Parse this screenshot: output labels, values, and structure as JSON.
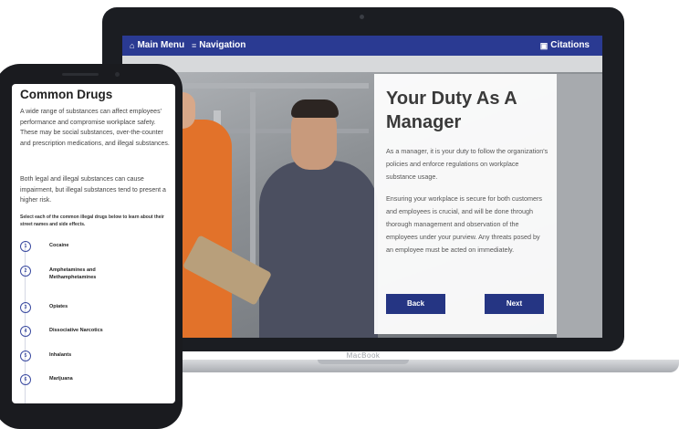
{
  "laptop": {
    "brand": "MacBook",
    "nav": {
      "main_menu": "Main Menu",
      "navigation": "Navigation",
      "citations": "Citations"
    },
    "card": {
      "title": "Your Duty As A Manager",
      "paragraph1": "As a manager, it is your duty to follow the organization's policies and enforce regulations on workplace substance usage.",
      "paragraph2": "Ensuring your workplace is secure for both customers and employees is crucial, and will be done through thorough management and observation of the employees under your purview. Any threats posed by an employee must be acted on immediately.",
      "back_label": "Back",
      "next_label": "Next"
    }
  },
  "phone": {
    "title": "Common Drugs",
    "paragraph1": "A wide range of substances can affect employees' performance and compromise workplace safety. These may be social substances, over-the-counter and prescription medications, and illegal substances.",
    "paragraph2": "Both legal and illegal substances can cause impairment, but illegal substances tend to present a higher risk.",
    "instruction": "Select each of the common illegal drugs below to learn about their street names and side effects.",
    "drugs": [
      {
        "num": "1",
        "label": "Cocaine"
      },
      {
        "num": "2",
        "label": "Amphetamines and Methamphetamines"
      },
      {
        "num": "3",
        "label": "Opiates"
      },
      {
        "num": "4",
        "label": "Dissociative Narcotics"
      },
      {
        "num": "5",
        "label": "Inhalants"
      },
      {
        "num": "6",
        "label": "Marijuana"
      }
    ]
  },
  "colors": {
    "nav_bg": "#2a3a92",
    "button_bg": "#253583",
    "accent": "#3a4aa0"
  },
  "icons": [
    "home-icon",
    "menu-icon",
    "book-icon"
  ]
}
